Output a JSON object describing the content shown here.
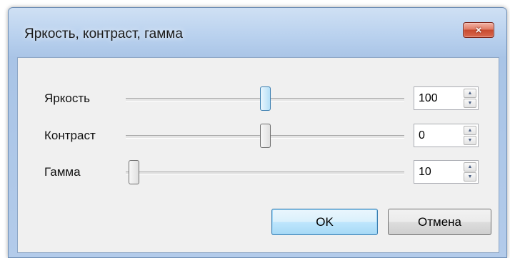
{
  "window": {
    "title": "Яркость, контраст, гамма",
    "close_icon": "×"
  },
  "sliders": [
    {
      "label": "Яркость",
      "value": "100",
      "position_fraction": 0.49,
      "focused": true
    },
    {
      "label": "Контраст",
      "value": "0",
      "position_fraction": 0.49,
      "focused": false
    },
    {
      "label": "Гамма",
      "value": "10",
      "position_fraction": 0.0,
      "focused": false
    }
  ],
  "buttons": {
    "ok": "OK",
    "cancel": "Отмена"
  },
  "colors": {
    "focus_accent": "#3c7fb1",
    "close_red": "#c74a2e"
  }
}
